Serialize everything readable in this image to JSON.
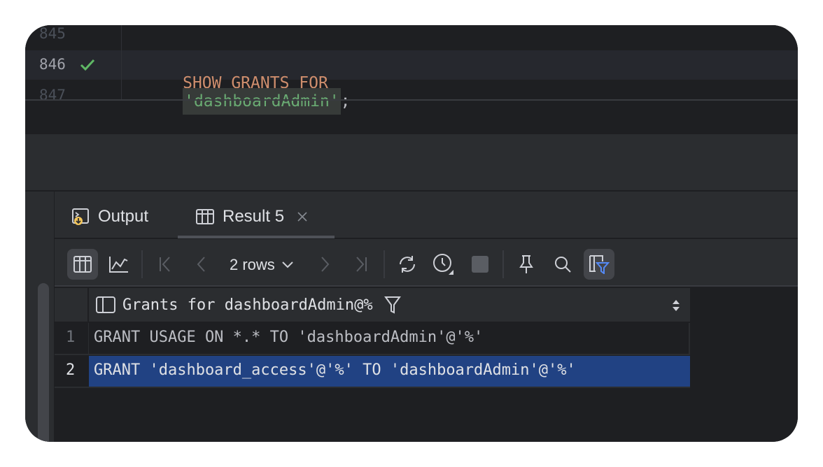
{
  "editor": {
    "lines": [
      {
        "number": "845",
        "text": ""
      },
      {
        "number": "846",
        "status": "check-icon",
        "keyword": "SHOW GRANTS FOR",
        "string": "'dashboardAdmin'",
        "punct": ";"
      },
      {
        "number": "847",
        "text": ""
      }
    ]
  },
  "panel": {
    "tabs": [
      {
        "label": "Output",
        "icon": "console-output-icon"
      },
      {
        "label": "Result 5",
        "icon": "table-icon",
        "selected": true,
        "closable": true
      }
    ],
    "toolbar": {
      "rows_label": "2 rows"
    },
    "grid": {
      "column": "Grants for dashboardAdmin@%",
      "rows": [
        {
          "num": "1",
          "value": "GRANT USAGE ON *.* TO 'dashboardAdmin'@'%'"
        },
        {
          "num": "2",
          "value": "GRANT 'dashboard_access'@'%' TO 'dashboardAdmin'@'%'",
          "selected": true
        }
      ]
    }
  },
  "colors": {
    "keyword": "#cf8e6d",
    "string": "#6aab73",
    "selection": "#214283",
    "check": "#5fb865"
  }
}
